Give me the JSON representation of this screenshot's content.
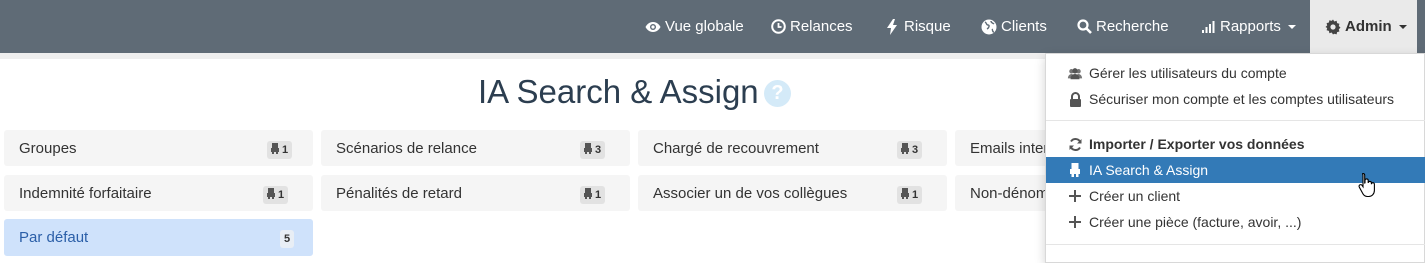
{
  "nav": {
    "items": [
      {
        "label": "Vue globale",
        "icon": "eye-icon"
      },
      {
        "label": "Relances",
        "icon": "clock-icon"
      },
      {
        "label": "Risque",
        "icon": "bolt-icon"
      },
      {
        "label": "Clients",
        "icon": "globe-icon"
      },
      {
        "label": "Recherche",
        "icon": "search-icon"
      },
      {
        "label": "Rapports",
        "icon": "signal-icon"
      },
      {
        "label": "Admin",
        "icon": "gear-icon"
      }
    ]
  },
  "page": {
    "title": "IA Search & Assign",
    "help": "?"
  },
  "cards": [
    {
      "label": "Groupes",
      "count": "1"
    },
    {
      "label": "Scénarios de relance",
      "count": "3"
    },
    {
      "label": "Chargé de recouvrement",
      "count": "3"
    },
    {
      "label": "Emails inter",
      "count": ""
    },
    {
      "label": "Indemnité forfaitaire",
      "count": "1"
    },
    {
      "label": "Pénalités de retard",
      "count": "1"
    },
    {
      "label": "Associer un de vos collègues",
      "count": "1"
    },
    {
      "label": "Non-dénom",
      "count": ""
    },
    {
      "label": "Par défaut",
      "count": "5"
    }
  ],
  "dropdown": {
    "items": [
      {
        "label": "Gérer les utilisateurs du compte",
        "icon": "users-icon"
      },
      {
        "label": "Sécuriser mon compte et les comptes utilisateurs",
        "icon": "lock-icon"
      },
      {
        "label": "Importer / Exporter vos données",
        "icon": "refresh-icon"
      },
      {
        "label": "IA Search & Assign",
        "icon": "robot-icon"
      },
      {
        "label": "Créer un client",
        "icon": "plus-icon"
      },
      {
        "label": "Créer une pièce (facture, avoir, ...)",
        "icon": "plus-icon"
      }
    ]
  },
  "colors": {
    "navbar": "#5f6b76",
    "active": "#337ab7",
    "selected_card": "#cfe2fb"
  }
}
